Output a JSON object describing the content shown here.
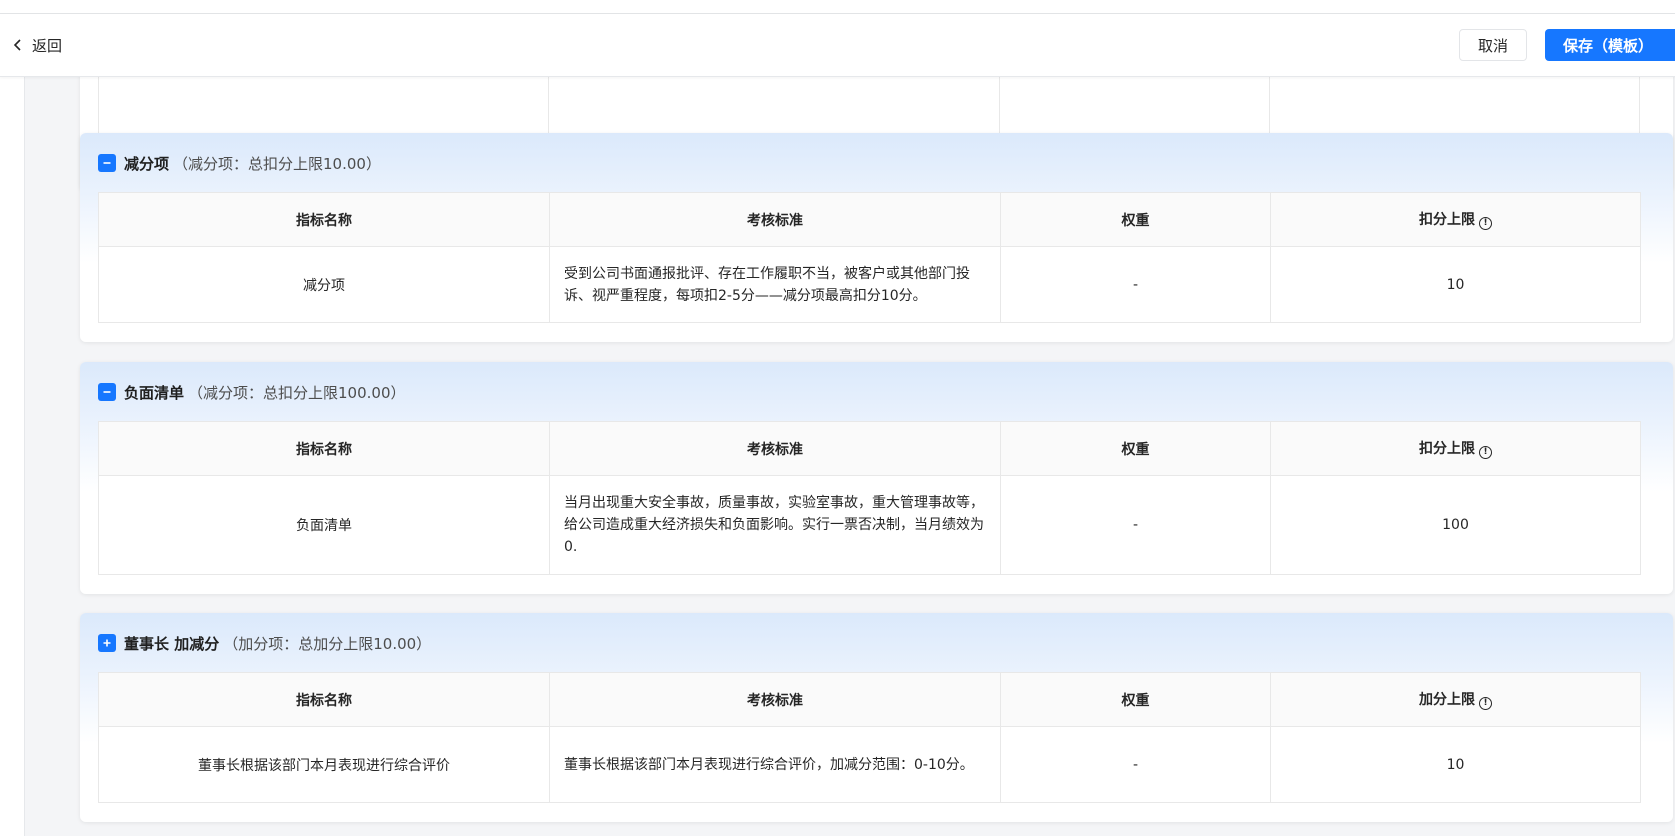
{
  "header": {
    "back_label": "返回",
    "cancel_label": "取消",
    "save_label": "保存（模板）"
  },
  "columns": {
    "name": "指标名称",
    "standard": "考核标准",
    "weight": "权重",
    "deduct_limit": "扣分上限",
    "add_limit": "加分上限"
  },
  "sections": [
    {
      "title": "减分项",
      "subtitle": "（减分项：总扣分上限10.00）",
      "toggle": "collapse",
      "row": {
        "name": "减分项",
        "standard": "受到公司书面通报批评、存在工作履职不当，被客户或其他部门投诉、视严重程度，每项扣2-5分——减分项最高扣分10分。",
        "weight": "-",
        "limit": "10"
      }
    },
    {
      "title": "负面清单",
      "subtitle": "（减分项：总扣分上限100.00）",
      "toggle": "collapse",
      "row": {
        "name": "负面清单",
        "standard": "当月出现重大安全事故，质量事故，实验室事故，重大管理事故等，给公司造成重大经济损失和负面影响。实行一票否决制，当月绩效为0.",
        "weight": "-",
        "limit": "100"
      }
    },
    {
      "title": "董事长 加减分",
      "subtitle": "（加分项：总加分上限10.00）",
      "toggle": "expand",
      "row": {
        "name": "董事长根据该部门本月表现进行综合评价",
        "standard": "董事长根据该部门本月表现进行综合评价，加减分范围：0-10分。",
        "weight": "-",
        "limit": "10"
      }
    }
  ],
  "colors": {
    "primary": "#1677ff",
    "card_gradient_top": "#dbe9fb"
  }
}
